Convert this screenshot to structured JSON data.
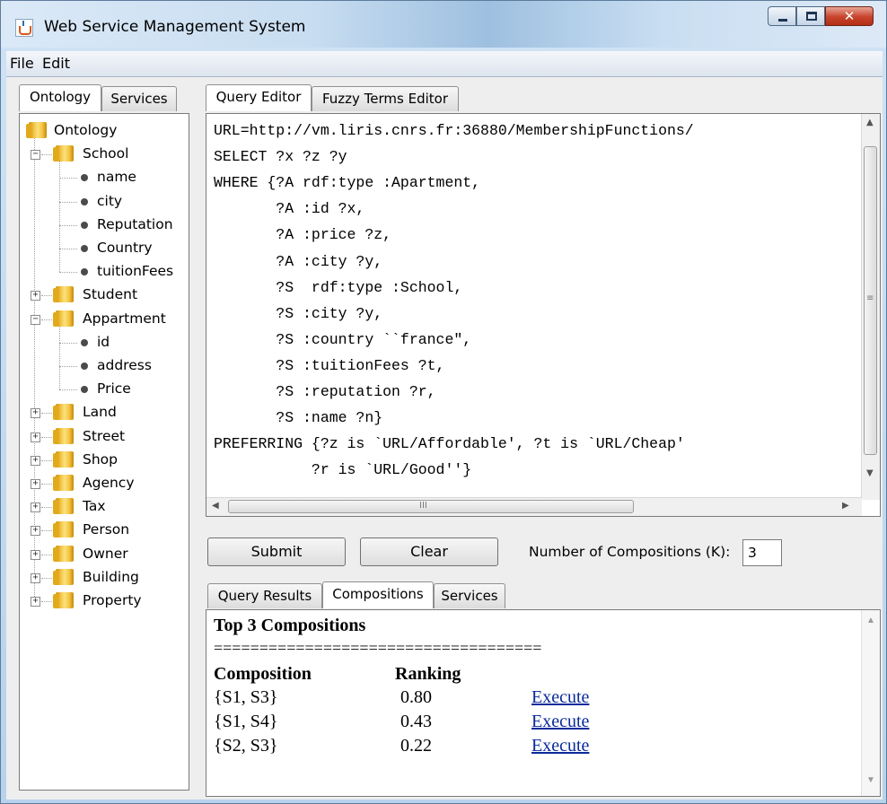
{
  "window": {
    "title": "Web Service Management System"
  },
  "menubar": {
    "items": [
      "File",
      "Edit"
    ]
  },
  "left_tabs": [
    {
      "label": "Ontology",
      "active": true
    },
    {
      "label": "Services",
      "active": false
    }
  ],
  "tree": {
    "root": "Ontology",
    "nodes": [
      {
        "label": "School",
        "expanded": true,
        "children": [
          "name",
          "city",
          "Reputation",
          "Country",
          "tuitionFees"
        ]
      },
      {
        "label": "Student",
        "expanded": false
      },
      {
        "label": "Appartment",
        "expanded": true,
        "children": [
          "id",
          "address",
          "Price"
        ]
      },
      {
        "label": "Land",
        "expanded": false
      },
      {
        "label": "Street",
        "expanded": false
      },
      {
        "label": "Shop",
        "expanded": false
      },
      {
        "label": "Agency",
        "expanded": false
      },
      {
        "label": "Tax",
        "expanded": false
      },
      {
        "label": "Person",
        "expanded": false
      },
      {
        "label": "Owner",
        "expanded": false
      },
      {
        "label": "Building",
        "expanded": false
      },
      {
        "label": "Property",
        "expanded": false
      }
    ]
  },
  "editor_tabs": [
    {
      "label": "Query Editor",
      "active": true
    },
    {
      "label": "Fuzzy Terms Editor",
      "active": false
    }
  ],
  "query_lines": [
    "URL=http://vm.liris.cnrs.fr:36880/MembershipFunctions/",
    "SELECT ?x ?z ?y",
    "WHERE {?A rdf:type :Apartment,",
    "       ?A :id ?x,",
    "       ?A :price ?z,",
    "       ?A :city ?y,",
    "       ?S  rdf:type :School,",
    "       ?S :city ?y,",
    "       ?S :country ``france\",",
    "       ?S :tuitionFees ?t,",
    "       ?S :reputation ?r,",
    "       ?S :name ?n}",
    "PREFERRING {?z is `URL/Affordable', ?t is `URL/Cheap'",
    "           ?r is `URL/Good''}"
  ],
  "actions": {
    "submit_label": "Submit",
    "clear_label": "Clear",
    "k_label": "Number of Compositions (K):",
    "k_value": "3"
  },
  "result_tabs": [
    {
      "label": "Query Results",
      "active": false
    },
    {
      "label": "Compositions",
      "active": true
    },
    {
      "label": "Services",
      "active": false
    }
  ],
  "compositions": {
    "heading": "Top 3 Compositions",
    "separator": "====================================",
    "col_composition": "Composition",
    "col_ranking": "Ranking",
    "rows": [
      {
        "composition": "{S1, S3}",
        "ranking": "0.80",
        "action": "Execute"
      },
      {
        "composition": "{S1, S4}",
        "ranking": "0.43",
        "action": "Execute"
      },
      {
        "composition": "{S2, S3}",
        "ranking": "0.22",
        "action": "Execute"
      }
    ]
  },
  "icons": {
    "app": "java-cup-icon",
    "folder": "folder-icon",
    "leaf": "bullet-icon"
  }
}
